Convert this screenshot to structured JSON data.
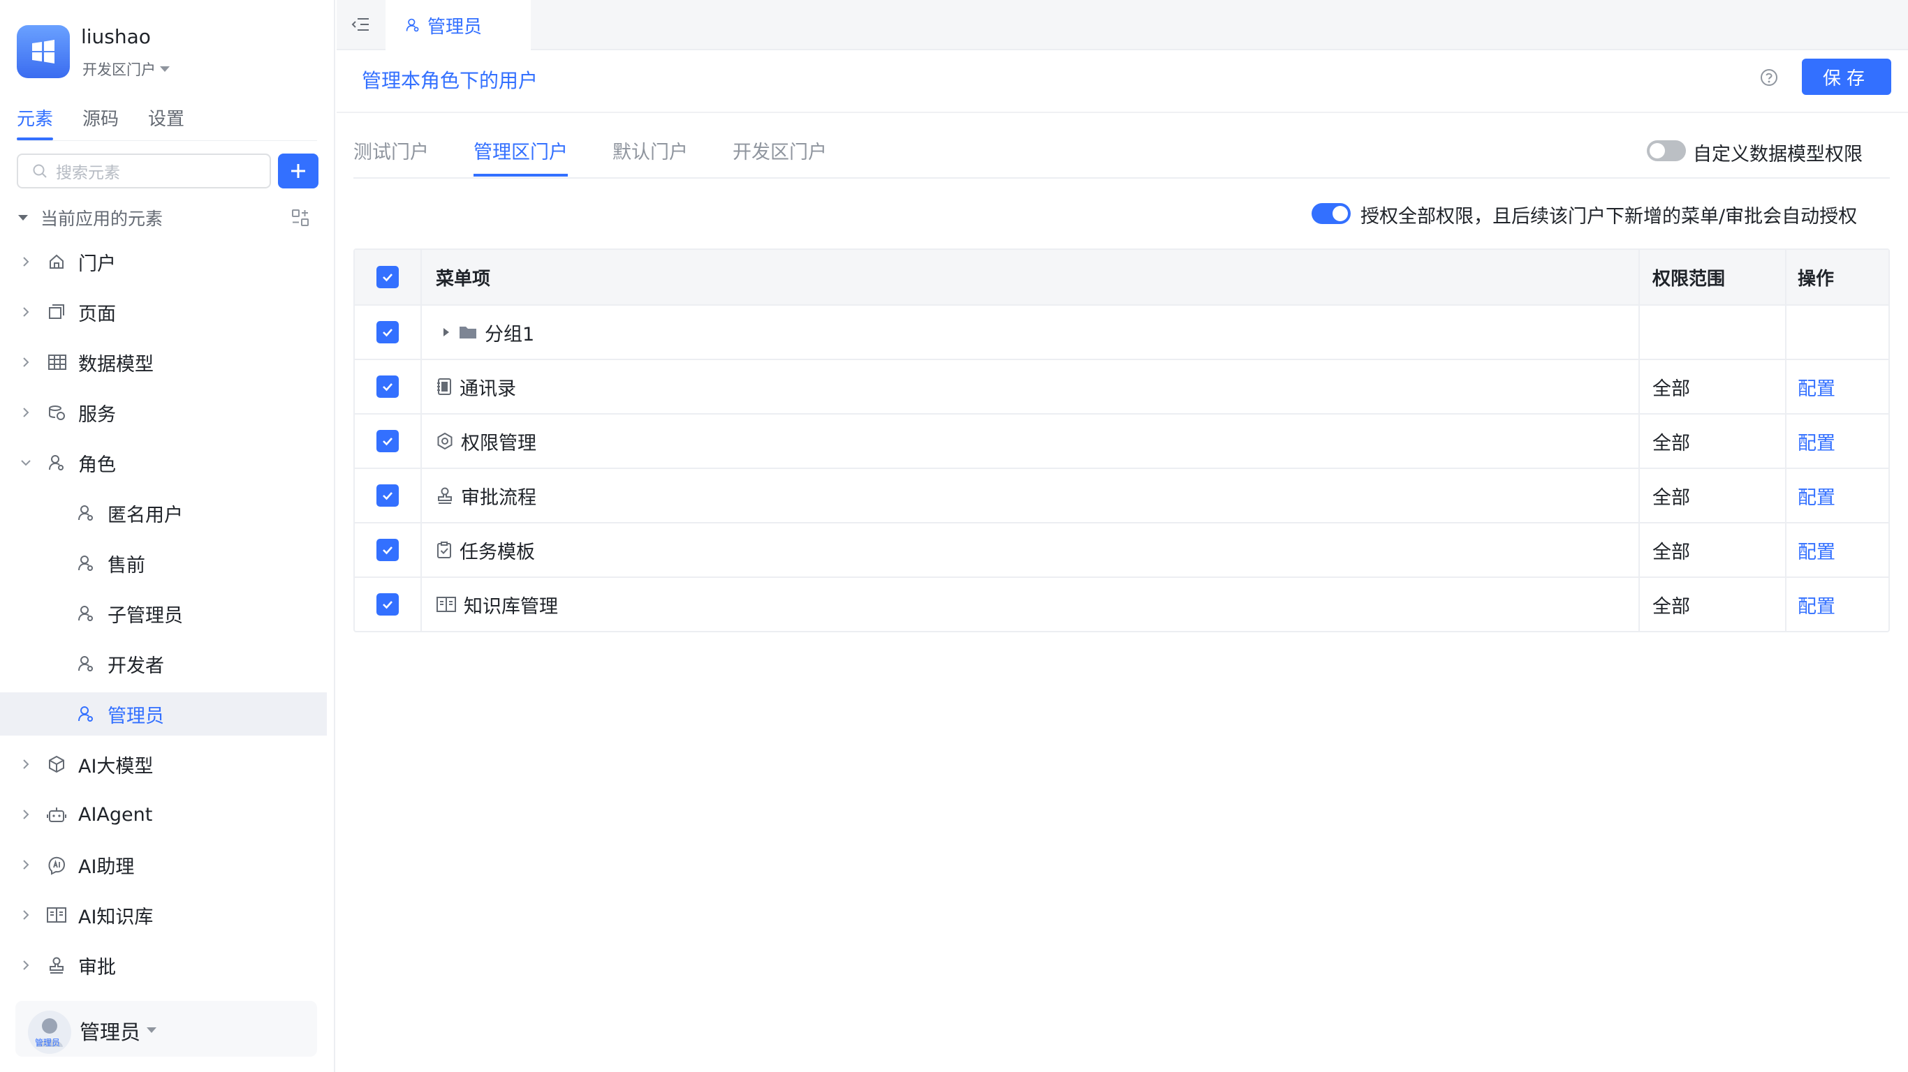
{
  "app": {
    "name": "liushao",
    "portal": "开发区门户"
  },
  "sidebar": {
    "tabs": [
      {
        "label": "元素"
      },
      {
        "label": "源码"
      },
      {
        "label": "设置"
      }
    ],
    "search_placeholder": "搜索元素",
    "tree_title": "当前应用的元素",
    "nodes": [
      {
        "label": "门户",
        "icon": "home-icon"
      },
      {
        "label": "页面",
        "icon": "page-icon"
      },
      {
        "label": "数据模型",
        "icon": "table-icon"
      },
      {
        "label": "服务",
        "icon": "service-icon"
      },
      {
        "label": "角色",
        "icon": "role-icon"
      },
      {
        "label": "匿名用户",
        "icon": "role-icon"
      },
      {
        "label": "售前",
        "icon": "role-icon"
      },
      {
        "label": "子管理员",
        "icon": "role-icon"
      },
      {
        "label": "开发者",
        "icon": "role-icon"
      },
      {
        "label": "管理员",
        "icon": "role-icon"
      },
      {
        "label": "AI大模型",
        "icon": "cube-icon"
      },
      {
        "label": "AIAgent",
        "icon": "robot-icon"
      },
      {
        "label": "AI助理",
        "icon": "ai-assistant-icon"
      },
      {
        "label": "AI知识库",
        "icon": "book-icon"
      },
      {
        "label": "审批",
        "icon": "stamp-icon"
      }
    ]
  },
  "user": {
    "name": "管理员",
    "avatar_tag": "管理员"
  },
  "page_tab": {
    "label": "管理员"
  },
  "header": {
    "title": "管理本角色下的用户",
    "save_label": "保存"
  },
  "portal_tabs": [
    {
      "label": "测试门户"
    },
    {
      "label": "管理区门户"
    },
    {
      "label": "默认门户"
    },
    {
      "label": "开发区门户"
    }
  ],
  "custom_toggle_label": "自定义数据模型权限",
  "auto_grant_label": "授权全部权限，且后续该门户下新增的菜单/审批会自动授权",
  "table": {
    "headers": {
      "name": "菜单项",
      "scope": "权限范围",
      "op": "操作"
    },
    "rows": [
      {
        "name": "分组1",
        "scope": "",
        "op": "",
        "icon": "folder-icon"
      },
      {
        "name": "通讯录",
        "scope": "全部",
        "op": "配置",
        "icon": "contacts-icon"
      },
      {
        "name": "权限管理",
        "scope": "全部",
        "op": "配置",
        "icon": "settings-icon"
      },
      {
        "name": "审批流程",
        "scope": "全部",
        "op": "配置",
        "icon": "stamp-icon"
      },
      {
        "name": "任务模板",
        "scope": "全部",
        "op": "配置",
        "icon": "task-icon"
      },
      {
        "name": "知识库管理",
        "scope": "全部",
        "op": "配置",
        "icon": "book-icon"
      }
    ]
  },
  "colors": {
    "accent": "#3370ff",
    "text": "#1f2329",
    "muted": "#646a73",
    "selected_bg": "#eef0f5"
  }
}
